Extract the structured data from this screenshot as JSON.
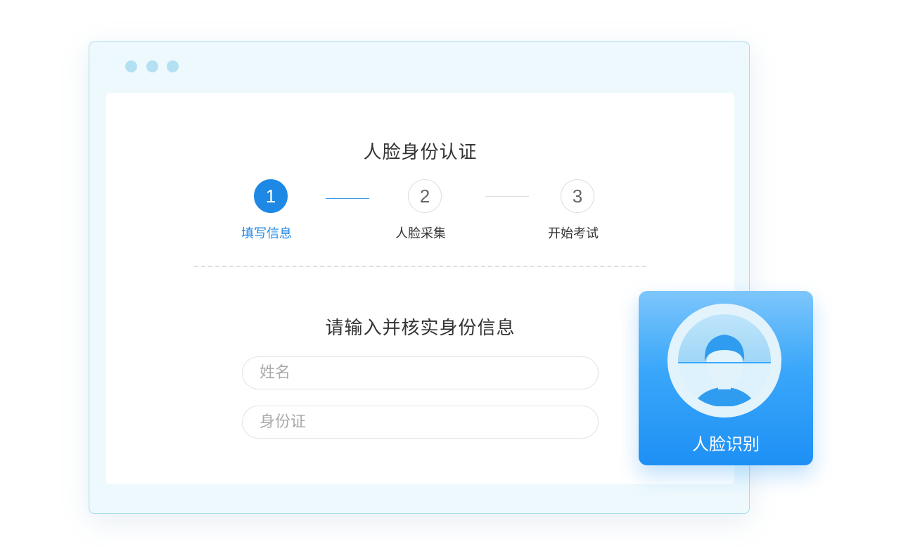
{
  "page": {
    "title": "人脸身份认证",
    "subtitle": "请输入并核实身份信息"
  },
  "steps": [
    {
      "number": "1",
      "label": "填写信息",
      "state": "active"
    },
    {
      "number": "2",
      "label": "人脸采集",
      "state": "idle"
    },
    {
      "number": "3",
      "label": "开始考试",
      "state": "idle"
    }
  ],
  "form": {
    "name_placeholder": "姓名",
    "id_placeholder": "身份证"
  },
  "face_card": {
    "label": "人脸识别",
    "icon": "face-scan-icon"
  },
  "colors": {
    "accent": "#1e88e5",
    "window_bg": "#eef9fd",
    "window_border": "#a9dcef",
    "window_dots": "#b3e1f3",
    "card_gradient_top": "#7dc6fb",
    "card_gradient_bottom": "#1e90f5"
  }
}
